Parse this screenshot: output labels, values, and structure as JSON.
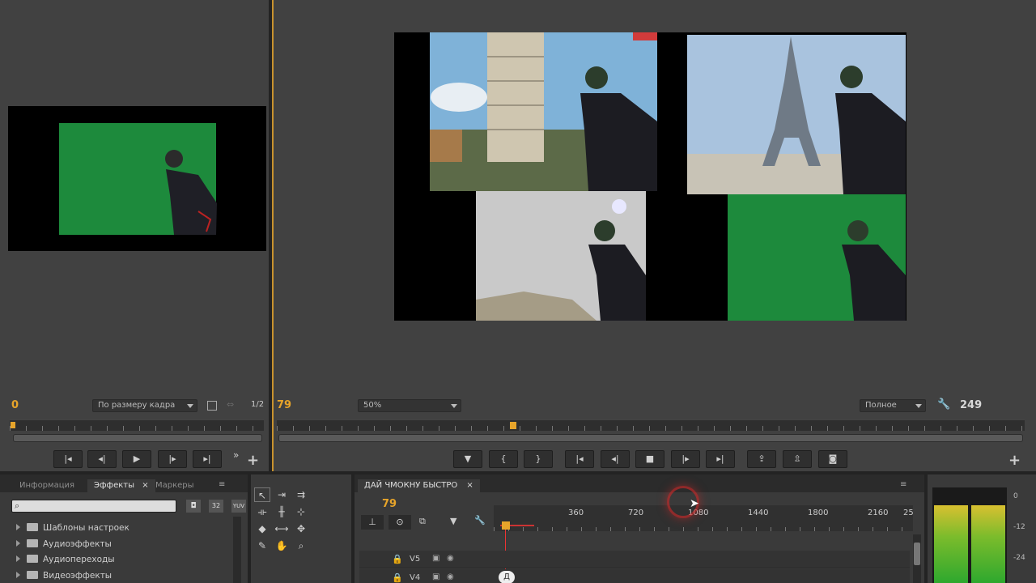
{
  "source": {
    "timecode": "0",
    "zoom": "По размеру кадра",
    "resolution": "1/2"
  },
  "program": {
    "timecode": "79",
    "zoom": "50%",
    "quality": "Полное",
    "duration": "249"
  },
  "effects": {
    "tabs": [
      "Информация",
      "Эффекты",
      "Маркеры"
    ],
    "active_tab": "Эффекты",
    "search_placeholder": "",
    "search_icons": [
      "32",
      "YUV"
    ],
    "items": [
      "Шаблоны настроек",
      "Аудиоэффекты",
      "Аудиопереходы",
      "Видеоэффекты"
    ]
  },
  "timeline": {
    "sequence_name": "ДАЙ ЧМОКНУ БЫСТРО",
    "timecode": "79",
    "ruler_labels": [
      "360",
      "720",
      "1080",
      "1440",
      "1800",
      "2160",
      "25"
    ],
    "tracks": [
      {
        "name": "V5"
      },
      {
        "name": "V4"
      }
    ],
    "clip_label": "Д"
  },
  "meter": {
    "labels": [
      "0",
      "-12",
      "-24"
    ]
  },
  "colors": {
    "accent": "#e7a42a",
    "panel": "#414141",
    "green_screen": "#1d8a3c"
  }
}
